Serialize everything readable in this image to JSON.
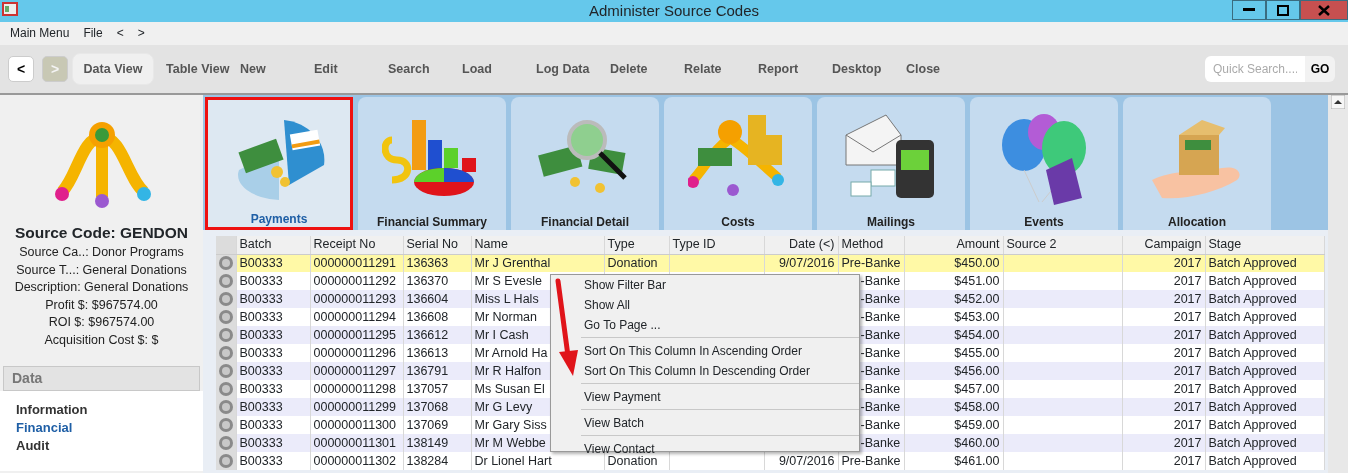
{
  "window": {
    "title": "Administer Source Codes"
  },
  "menu_bar": [
    "Main Menu",
    "File",
    "<",
    ">"
  ],
  "toolbar": {
    "back": {
      "label": "<",
      "disabled": false
    },
    "forward": {
      "label": ">",
      "disabled": true
    },
    "buttons": [
      {
        "label": "Data View",
        "selected": true
      },
      {
        "label": "Table View",
        "selected": false
      },
      {
        "label": "New",
        "selected": false
      },
      {
        "label": "Edit",
        "selected": false
      },
      {
        "label": "Search",
        "selected": false
      },
      {
        "label": "Load",
        "selected": false
      },
      {
        "label": "Log Data",
        "selected": false
      },
      {
        "label": "Delete",
        "selected": false
      },
      {
        "label": "Relate",
        "selected": false
      },
      {
        "label": "Report",
        "selected": false
      },
      {
        "label": "Desktop",
        "selected": false
      },
      {
        "label": "Close",
        "selected": false
      }
    ],
    "quick_search": {
      "placeholder": "Quick Search....",
      "button": "GO"
    }
  },
  "source": {
    "title": "Source Code: GENDON",
    "details": [
      "Source Ca..: Donor Programs",
      "Source T...: General Donations",
      "Description: General Donations",
      "Profit $: $967574.00",
      "ROI $: $967574.00",
      "Acquisition Cost $: $"
    ]
  },
  "data_nav": {
    "heading": "Data",
    "items": [
      {
        "label": "Information",
        "selected": false
      },
      {
        "label": "Financial",
        "selected": true
      },
      {
        "label": "Audit",
        "selected": false
      }
    ]
  },
  "tiles": [
    {
      "label": "Payments",
      "kind": "payments",
      "selected": true
    },
    {
      "label": "Financial Summary",
      "kind": "summary",
      "selected": false
    },
    {
      "label": "Financial Detail",
      "kind": "detail",
      "selected": false
    },
    {
      "label": "Costs",
      "kind": "costs",
      "selected": false
    },
    {
      "label": "Mailings",
      "kind": "mailings",
      "selected": false
    },
    {
      "label": "Events",
      "kind": "events",
      "selected": false
    },
    {
      "label": "Allocation",
      "kind": "allocation",
      "selected": false
    }
  ],
  "table": {
    "columns": [
      "Batch",
      "Receipt No",
      "Serial No",
      "Name",
      "Type",
      "Type ID",
      "Date (<)",
      "Method",
      "Amount",
      "Source 2",
      "Campaign",
      "Stage"
    ],
    "rows": [
      {
        "selected": true,
        "batch": "B00333",
        "receipt_no": "000000011291",
        "serial_no": "136363",
        "name": "Mr J Grenthal",
        "type": "Donation",
        "date": "9/07/2016",
        "method": "Pre-Banke",
        "amount": "$450.00",
        "campaign": "2017",
        "stage": "Batch Approved"
      },
      {
        "selected": false,
        "batch": "B00333",
        "receipt_no": "000000011292",
        "serial_no": "136370",
        "name": "Mr S Evesle",
        "method": "-Banke",
        "amount": "$451.00",
        "campaign": "2017",
        "stage": "Batch Approved"
      },
      {
        "selected": false,
        "batch": "B00333",
        "receipt_no": "000000011293",
        "serial_no": "136604",
        "name": "Miss L Hals",
        "method": "-Banke",
        "amount": "$452.00",
        "campaign": "2017",
        "stage": "Batch Approved"
      },
      {
        "selected": false,
        "batch": "B00333",
        "receipt_no": "000000011294",
        "serial_no": "136608",
        "name": "Mr Norman",
        "method": "-Banke",
        "amount": "$453.00",
        "campaign": "2017",
        "stage": "Batch Approved"
      },
      {
        "selected": false,
        "batch": "B00333",
        "receipt_no": "000000011295",
        "serial_no": "136612",
        "name": "Mr I Cash",
        "method": "-Banke",
        "amount": "$454.00",
        "campaign": "2017",
        "stage": "Batch Approved"
      },
      {
        "selected": false,
        "batch": "B00333",
        "receipt_no": "000000011296",
        "serial_no": "136613",
        "name": "Mr Arnold Ha",
        "method": "-Banke",
        "amount": "$455.00",
        "campaign": "2017",
        "stage": "Batch Approved"
      },
      {
        "selected": false,
        "batch": "B00333",
        "receipt_no": "000000011297",
        "serial_no": "136791",
        "name": "Mr R Halfon",
        "method": "-Banke",
        "amount": "$456.00",
        "campaign": "2017",
        "stage": "Batch Approved"
      },
      {
        "selected": false,
        "batch": "B00333",
        "receipt_no": "000000011298",
        "serial_no": "137057",
        "name": "Ms Susan El",
        "method": "-Banke",
        "amount": "$457.00",
        "campaign": "2017",
        "stage": "Batch Approved"
      },
      {
        "selected": false,
        "batch": "B00333",
        "receipt_no": "000000011299",
        "serial_no": "137068",
        "name": "Mr G Levy",
        "method": "-Banke",
        "amount": "$458.00",
        "campaign": "2017",
        "stage": "Batch Approved"
      },
      {
        "selected": false,
        "batch": "B00333",
        "receipt_no": "000000011300",
        "serial_no": "137069",
        "name": "Mr Gary Siss",
        "method": "-Banke",
        "amount": "$459.00",
        "campaign": "2017",
        "stage": "Batch Approved"
      },
      {
        "selected": false,
        "batch": "B00333",
        "receipt_no": "000000011301",
        "serial_no": "138149",
        "name": "Mr M Webbe",
        "method": "-Banke",
        "amount": "$460.00",
        "campaign": "2017",
        "stage": "Batch Approved"
      },
      {
        "selected": false,
        "batch": "B00333",
        "receipt_no": "000000011302",
        "serial_no": "138284",
        "name": "Dr Lionel Hart",
        "type": "Donation",
        "date": "9/07/2016",
        "method": "Pre-Banke",
        "amount": "$461.00",
        "campaign": "2017",
        "stage": "Batch Approved"
      }
    ]
  },
  "context_menu": {
    "groups": [
      [
        "Show Filter Bar",
        "Show All",
        "Go To Page ..."
      ],
      [
        "Sort On This Column In Ascending Order",
        "Sort On This Column In Descending Order"
      ],
      [
        "View Payment"
      ],
      [
        "View Batch"
      ],
      [
        "View Contact"
      ]
    ]
  }
}
